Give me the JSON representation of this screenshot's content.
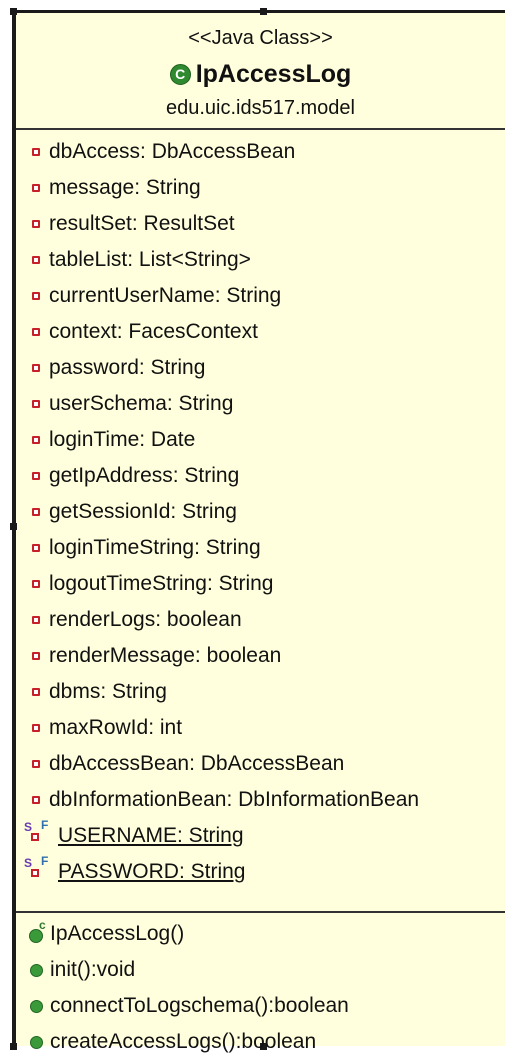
{
  "diagram": {
    "stereotype": "<<Java Class>>",
    "class_name": "IpAccessLog",
    "class_icon_glyph": "C",
    "package": "edu.uic.ids517.model",
    "attributes": [
      {
        "text": "dbAccess: DbAccessBean"
      },
      {
        "text": "message: String"
      },
      {
        "text": "resultSet: ResultSet"
      },
      {
        "text": "tableList: List<String>"
      },
      {
        "text": "currentUserName: String"
      },
      {
        "text": "context: FacesContext"
      },
      {
        "text": "password: String"
      },
      {
        "text": "userSchema: String"
      },
      {
        "text": "loginTime: Date"
      },
      {
        "text": "getIpAddress: String"
      },
      {
        "text": "getSessionId: String"
      },
      {
        "text": "loginTimeString: String"
      },
      {
        "text": "logoutTimeString: String"
      },
      {
        "text": "renderLogs: boolean"
      },
      {
        "text": "renderMessage: boolean"
      },
      {
        "text": "dbms: String"
      },
      {
        "text": "maxRowId: int"
      },
      {
        "text": "dbAccessBean: DbAccessBean"
      },
      {
        "text": "dbInformationBean: DbInformationBean"
      }
    ],
    "static_attributes": [
      {
        "text": "USERNAME: String",
        "mark_s": "S",
        "mark_f": "F"
      },
      {
        "text": "PASSWORD: String",
        "mark_s": "S",
        "mark_f": "F"
      }
    ],
    "constructor": {
      "text": "IpAccessLog()",
      "mark": "c"
    },
    "operations": [
      {
        "text": "init():void"
      },
      {
        "text": "connectToLogschema():boolean"
      },
      {
        "text": "createAccessLogs():boolean"
      }
    ]
  },
  "colors": {
    "box_fill": "#ffffdd",
    "private_icon": "#c8202a",
    "public_icon": "#3a9a3a"
  }
}
